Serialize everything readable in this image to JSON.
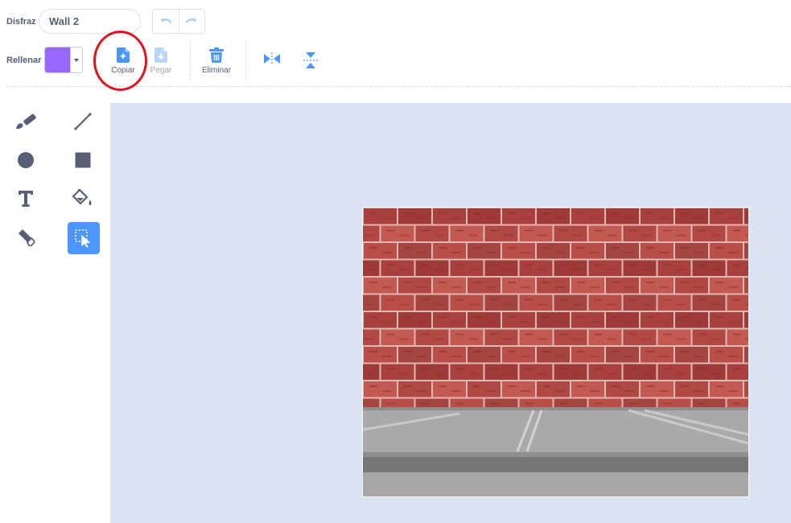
{
  "costume": {
    "label": "Disfraz",
    "name": "Wall 2"
  },
  "fill": {
    "label": "Rellenar",
    "color": "#9966ff"
  },
  "toolbar": {
    "copy_label": "Copiar",
    "paste_label": "Pegar",
    "delete_label": "Eliminar",
    "flip_h_icon": "flip-horizontal-icon",
    "flip_v_icon": "flip-vertical-icon"
  },
  "annotation": {
    "highlighted": "copy-button",
    "color": "#e3131e"
  },
  "tools": [
    "brush-icon",
    "line-icon",
    "circle-icon",
    "rectangle-icon",
    "text-icon",
    "fill-bucket-icon",
    "eraser-icon",
    "select-icon"
  ],
  "active_tool": "select-icon",
  "colors": {
    "accent": "#4c97ff",
    "canvas_background": "#d9e3f2",
    "text": "#575e75",
    "brick": "#b04844",
    "mortar": "#e0b8b4",
    "pavement": "#a8a8a8"
  },
  "costume_image": {
    "name": "Wall 2",
    "description_shown": "brick wall over gray pavement"
  }
}
